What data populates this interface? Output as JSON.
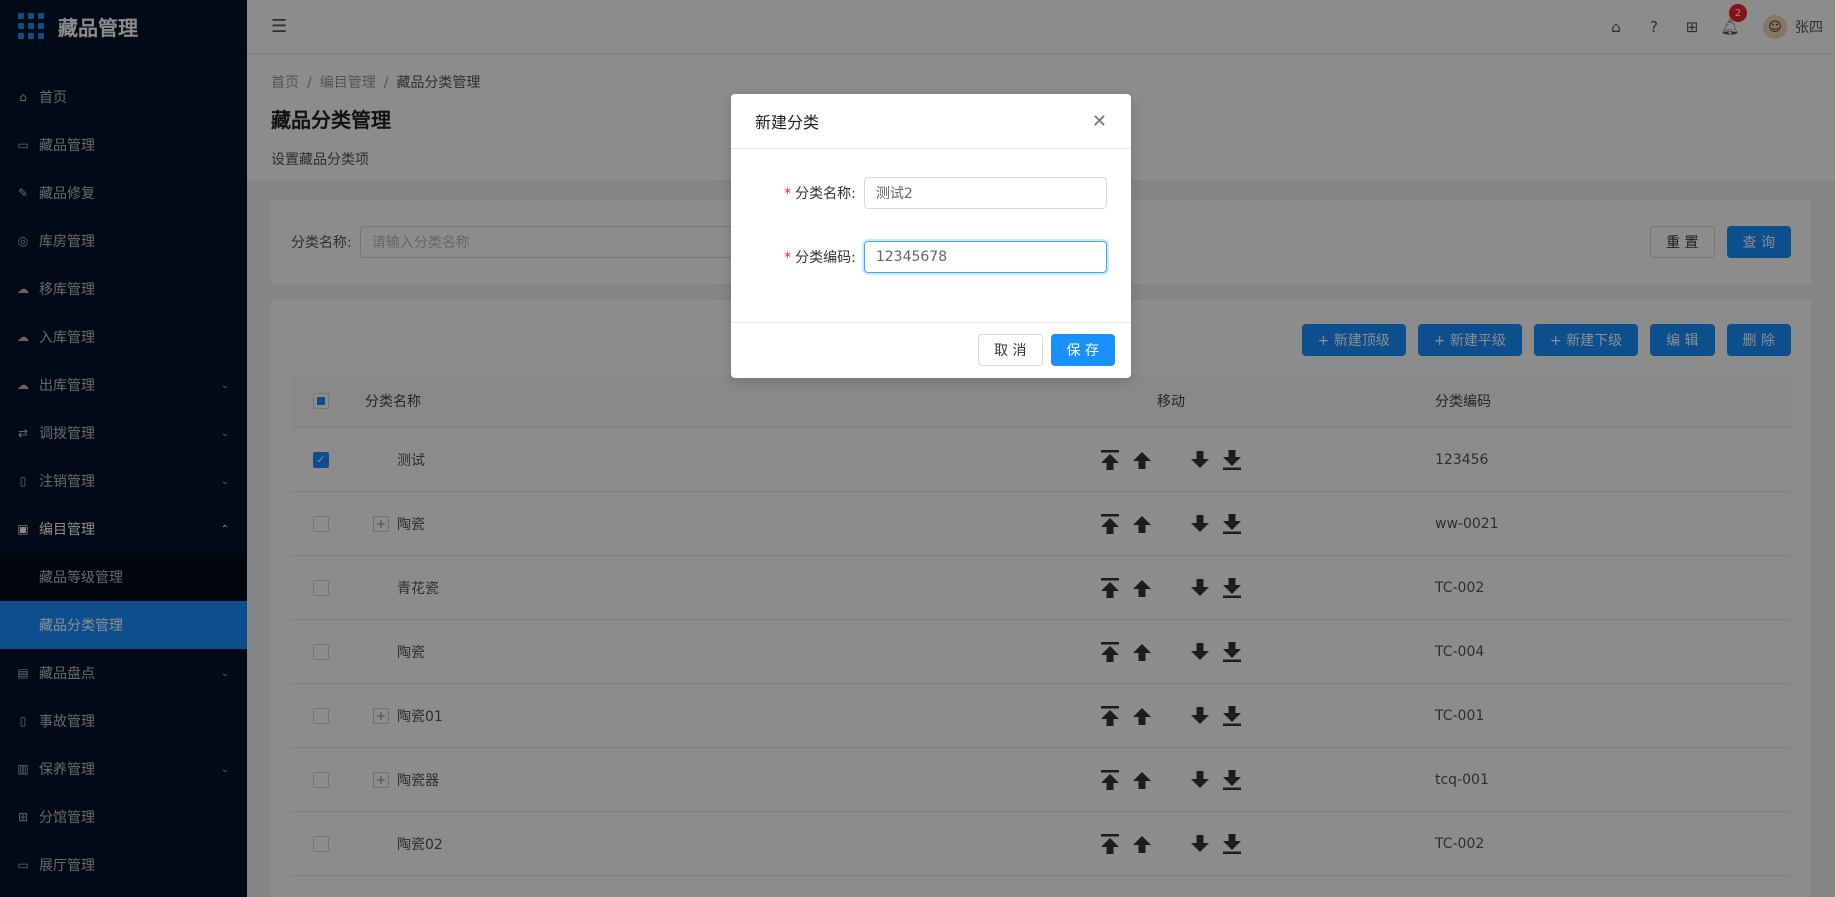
{
  "app": {
    "title": "藏品管理"
  },
  "sidebar": {
    "items": [
      {
        "label": "首页",
        "icon": "home-icon"
      },
      {
        "label": "藏品管理",
        "icon": "calendar-icon"
      },
      {
        "label": "藏品修复",
        "icon": "wrench-icon"
      },
      {
        "label": "库房管理",
        "icon": "warehouse-icon"
      },
      {
        "label": "移库管理",
        "icon": "cloud-sync-icon"
      },
      {
        "label": "入库管理",
        "icon": "cloud-upload-icon"
      },
      {
        "label": "出库管理",
        "icon": "cloud-download-icon"
      },
      {
        "label": "调拨管理",
        "icon": "transfer-icon"
      },
      {
        "label": "注销管理",
        "icon": "file-icon"
      },
      {
        "label": "编目管理",
        "icon": "catalog-icon"
      },
      {
        "label": "藏品等级管理"
      },
      {
        "label": "藏品分类管理"
      },
      {
        "label": "藏品盘点",
        "icon": "inventory-icon"
      },
      {
        "label": "事故管理",
        "icon": "accident-icon"
      },
      {
        "label": "保养管理",
        "icon": "maintain-icon"
      },
      {
        "label": "分馆管理",
        "icon": "branch-icon"
      },
      {
        "label": "展厅管理",
        "icon": "hall-icon"
      }
    ]
  },
  "header": {
    "notification_count": "2",
    "username": "张四"
  },
  "breadcrumb": [
    "首页",
    "编目管理",
    "藏品分类管理"
  ],
  "page": {
    "title": "藏品分类管理",
    "description": "设置藏品分类项"
  },
  "search": {
    "label": "分类名称:",
    "placeholder": "请输入分类名称",
    "reset_label": "重 置",
    "query_label": "查 询"
  },
  "toolbar": {
    "new_top": "+ 新建顶级",
    "new_same": "+ 新建平级",
    "new_child": "+ 新建下级",
    "edit": "编 辑",
    "delete": "删 除"
  },
  "table": {
    "columns": [
      "分类名称",
      "移动",
      "分类编码"
    ],
    "rows": [
      {
        "name": "测试",
        "code": "123456",
        "checked": true,
        "expandable": false
      },
      {
        "name": "陶瓷",
        "code": "ww-0021",
        "checked": false,
        "expandable": true
      },
      {
        "name": "青花瓷",
        "code": "TC-002",
        "checked": false,
        "expandable": false
      },
      {
        "name": "陶瓷",
        "code": "TC-004",
        "checked": false,
        "expandable": false
      },
      {
        "name": "陶瓷01",
        "code": "TC-001",
        "checked": false,
        "expandable": true
      },
      {
        "name": "陶瓷器",
        "code": "tcq-001",
        "checked": false,
        "expandable": true
      },
      {
        "name": "陶瓷02",
        "code": "TC-002",
        "checked": false,
        "expandable": false
      }
    ]
  },
  "modal": {
    "title": "新建分类",
    "name_label": "分类名称:",
    "name_value": "测试2",
    "code_label": "分类编码:",
    "code_value": "12345678",
    "cancel_label": "取 消",
    "save_label": "保 存"
  },
  "colors": {
    "primary": "#1890ff",
    "sidebar_bg": "#001529",
    "danger": "#f5222d"
  }
}
